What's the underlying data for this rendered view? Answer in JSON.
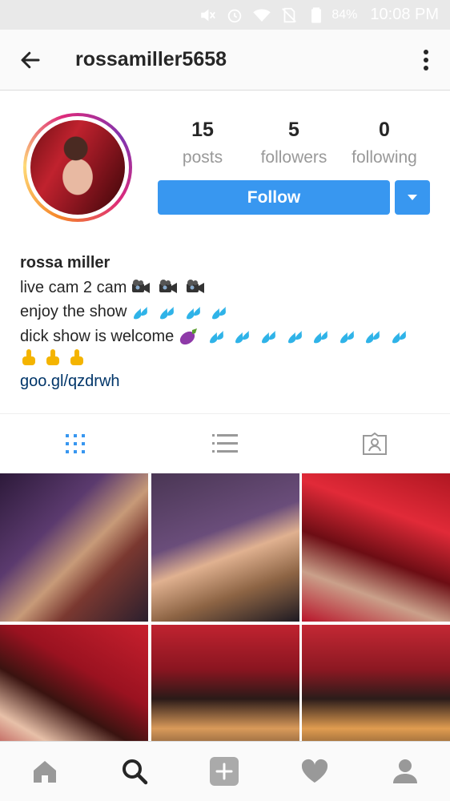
{
  "status_bar": {
    "battery_percent": "84%",
    "time": "10:08 PM",
    "icons": [
      "mute-icon",
      "alarm-icon",
      "wifi-icon",
      "no-sim-icon",
      "battery-icon"
    ]
  },
  "app_bar": {
    "username": "rossamiller5658",
    "back_icon": "back-arrow-icon",
    "more_icon": "more-vertical-icon"
  },
  "profile": {
    "stats": [
      {
        "value": "15",
        "label": "posts"
      },
      {
        "value": "5",
        "label": "followers"
      },
      {
        "value": "0",
        "label": "following"
      }
    ],
    "follow_label": "Follow",
    "accent_color": "#3897f0",
    "bio": {
      "name": "rossa miller",
      "line1": "live cam 2 cam",
      "line1_emoji": [
        "video-camera",
        "video-camera",
        "video-camera"
      ],
      "line2": "enjoy the show",
      "line2_emoji": [
        "sweat-droplets",
        "sweat-droplets",
        "sweat-droplets",
        "sweat-droplets"
      ],
      "line3": "dick show is welcome",
      "line3_emoji": [
        "eggplant",
        "sweat-droplets",
        "sweat-droplets",
        "sweat-droplets",
        "sweat-droplets",
        "sweat-droplets",
        "sweat-droplets",
        "sweat-droplets",
        "sweat-droplets"
      ],
      "line4_emoji": [
        "pointing-down",
        "pointing-down",
        "pointing-down"
      ],
      "link": "goo.gl/qzdrwh",
      "link_color": "#003569"
    }
  },
  "tabs": [
    {
      "name": "grid-view-icon",
      "active": true
    },
    {
      "name": "list-view-icon",
      "active": false
    },
    {
      "name": "tagged-photos-icon",
      "active": false
    }
  ],
  "posts_visible": 6,
  "bottom_nav": [
    "home-icon",
    "search-icon",
    "add-post-icon",
    "activity-heart-icon",
    "profile-icon"
  ]
}
